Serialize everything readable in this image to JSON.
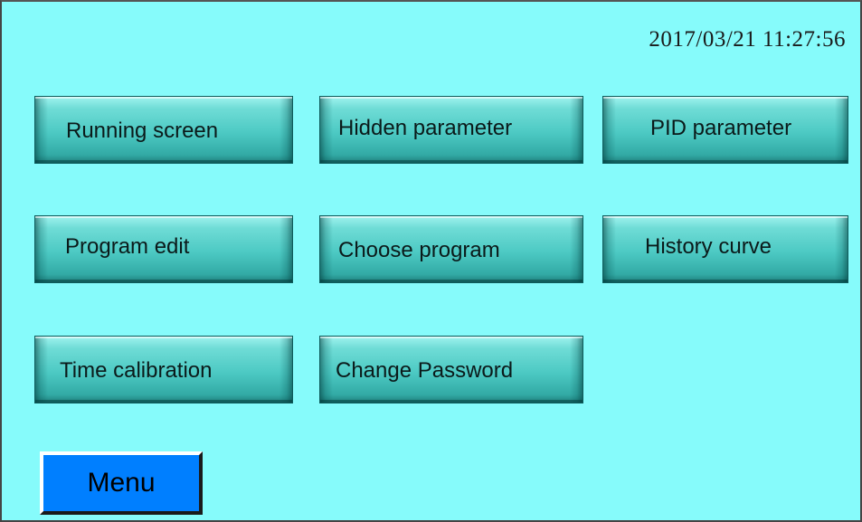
{
  "header": {
    "datetime": "2017/03/21 11:27:56"
  },
  "menu": {
    "items": [
      {
        "label": "Running screen"
      },
      {
        "label": "Hidden parameter"
      },
      {
        "label": "PID parameter"
      },
      {
        "label": "Program edit"
      },
      {
        "label": "Choose program"
      },
      {
        "label": "History curve"
      },
      {
        "label": "Time calibration"
      },
      {
        "label": "Change Password"
      }
    ]
  },
  "footer": {
    "menu_label": "Menu"
  },
  "colors": {
    "background": "#86fbfb",
    "button_teal": "#4cc9c3",
    "menu_button_blue": "#007fff"
  }
}
